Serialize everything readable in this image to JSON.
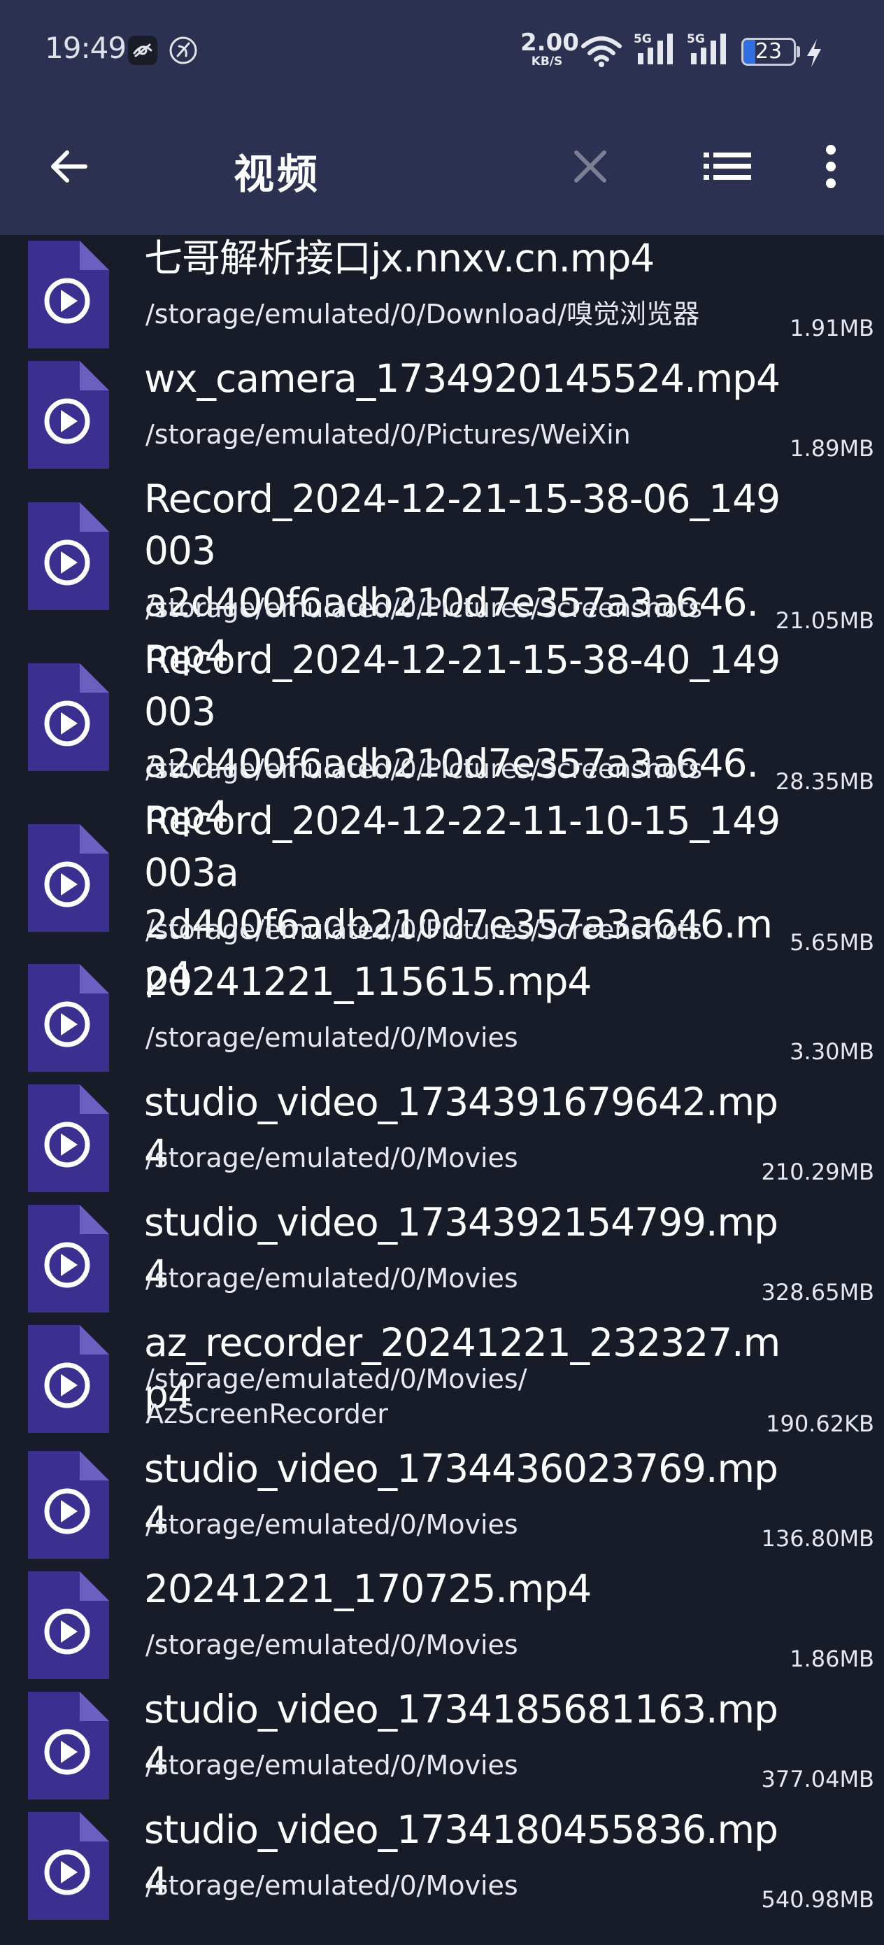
{
  "status_bar": {
    "time": "19:49",
    "net_speed_value": "2.00",
    "net_speed_unit": "KB/S",
    "sim1_tag": "5G",
    "sim2_tag": "5G",
    "battery_level": "23",
    "battery_fraction": 0.23
  },
  "toolbar": {
    "title": "视频",
    "back_icon": "arrow-left-icon",
    "clear_icon": "close-icon",
    "list_icon": "list-view-icon",
    "more_icon": "more-vertical-icon"
  },
  "colors": {
    "header_bg": "#2d3151",
    "list_bg": "#181b28",
    "file_icon": "#3b2f8f",
    "file_icon_fold": "#6c5fc0"
  },
  "files": [
    {
      "name": "七哥解析接口jx.nnxv.cn.mp4",
      "path": "/storage/emulated/0/Download/嗅觉浏览器",
      "size": "1.91MB"
    },
    {
      "name": "wx_camera_1734920145524.mp4",
      "path": "/storage/emulated/0/Pictures/WeiXin",
      "size": "1.89MB"
    },
    {
      "name": "Record_2024-12-21-15-38-06_149003\na2d400f6adb210d7e357a3a646.mp4",
      "path": "/storage/emulated/0/Pictures/Screenshots",
      "size": "21.05MB"
    },
    {
      "name": "Record_2024-12-21-15-38-40_149003\na2d400f6adb210d7e357a3a646.mp4",
      "path": "/storage/emulated/0/Pictures/Screenshots",
      "size": "28.35MB"
    },
    {
      "name": "Record_2024-12-22-11-10-15_149003a\n2d400f6adb210d7e357a3a646.mp4",
      "path": "/storage/emulated/0/Pictures/Screenshots",
      "size": "5.65MB"
    },
    {
      "name": "20241221_115615.mp4",
      "path": "/storage/emulated/0/Movies",
      "size": "3.30MB"
    },
    {
      "name": "studio_video_1734391679642.mp4",
      "path": "/storage/emulated/0/Movies",
      "size": "210.29MB"
    },
    {
      "name": "studio_video_1734392154799.mp4",
      "path": "/storage/emulated/0/Movies",
      "size": "328.65MB"
    },
    {
      "name": "az_recorder_20241221_232327.mp4",
      "path": "/storage/emulated/0/Movies/\nAzScreenRecorder",
      "size": "190.62KB"
    },
    {
      "name": "studio_video_1734436023769.mp4",
      "path": "/storage/emulated/0/Movies",
      "size": "136.80MB"
    },
    {
      "name": "20241221_170725.mp4",
      "path": "/storage/emulated/0/Movies",
      "size": "1.86MB"
    },
    {
      "name": "studio_video_1734185681163.mp4",
      "path": "/storage/emulated/0/Movies",
      "size": "377.04MB"
    },
    {
      "name": "studio_video_1734180455836.mp4",
      "path": "/storage/emulated/0/Movies",
      "size": "540.98MB"
    }
  ]
}
